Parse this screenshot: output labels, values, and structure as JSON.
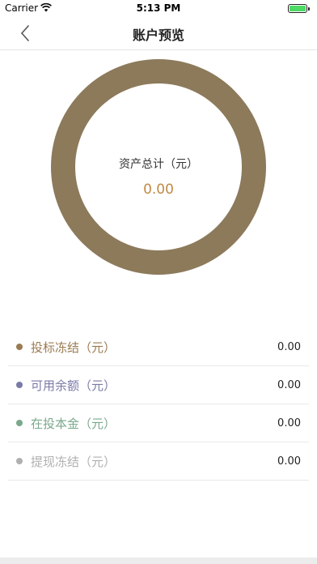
{
  "status_bar": {
    "carrier": "Carrier",
    "time": "5:13 PM",
    "battery_color": "#4cd964"
  },
  "nav": {
    "title": "账户预览",
    "back_icon": "chevron-left-icon"
  },
  "summary": {
    "label": "资产总计（元）",
    "value": "0.00",
    "ring_color": "#8c7a5b",
    "value_color": "#c08a45"
  },
  "items": [
    {
      "label": "投标冻结（元）",
      "value": "0.00",
      "color": "#9a7b52"
    },
    {
      "label": "可用余额（元）",
      "value": "0.00",
      "color": "#7a7aa8"
    },
    {
      "label": "在投本金（元）",
      "value": "0.00",
      "color": "#7aa88c"
    },
    {
      "label": "提现冻结（元）",
      "value": "0.00",
      "color": "#b0b0b0"
    }
  ]
}
